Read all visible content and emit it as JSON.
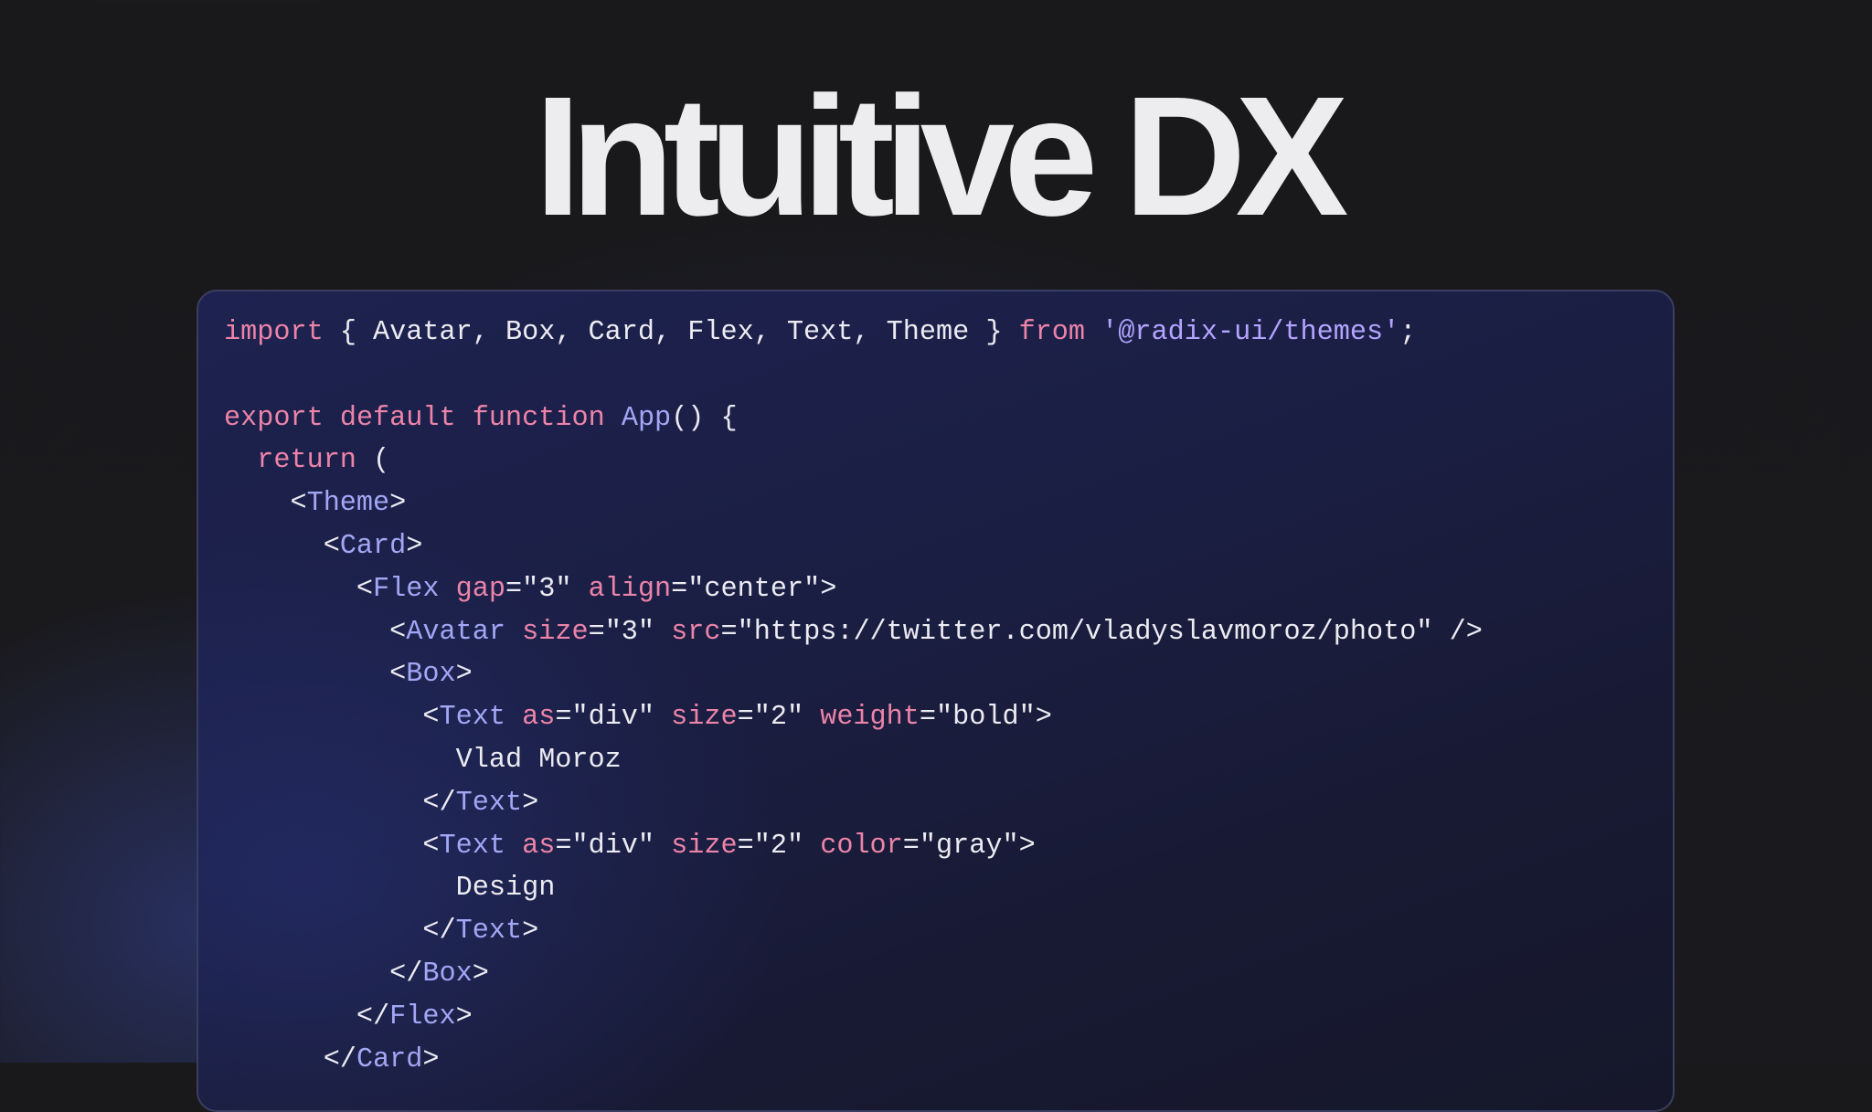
{
  "hero": {
    "title": "Intuitive DX"
  },
  "code": {
    "lines": [
      [
        {
          "t": "import",
          "k": "keyword"
        },
        {
          "t": " { Avatar, Box, Card, Flex, Text, Theme } ",
          "k": "plain"
        },
        {
          "t": "from",
          "k": "keyword"
        },
        {
          "t": " ",
          "k": "plain"
        },
        {
          "t": "'@radix-ui/themes'",
          "k": "string"
        },
        {
          "t": ";",
          "k": "plain"
        }
      ],
      [],
      [
        {
          "t": "export",
          "k": "keyword"
        },
        {
          "t": " ",
          "k": "plain"
        },
        {
          "t": "default",
          "k": "keyword"
        },
        {
          "t": " ",
          "k": "plain"
        },
        {
          "t": "function",
          "k": "keyword"
        },
        {
          "t": " ",
          "k": "plain"
        },
        {
          "t": "App",
          "k": "tag"
        },
        {
          "t": "() {",
          "k": "plain"
        }
      ],
      [
        {
          "t": "  ",
          "k": "plain"
        },
        {
          "t": "return",
          "k": "keyword"
        },
        {
          "t": " (",
          "k": "plain"
        }
      ],
      [
        {
          "t": "    <",
          "k": "plain"
        },
        {
          "t": "Theme",
          "k": "tag"
        },
        {
          "t": ">",
          "k": "plain"
        }
      ],
      [
        {
          "t": "      <",
          "k": "plain"
        },
        {
          "t": "Card",
          "k": "tag"
        },
        {
          "t": ">",
          "k": "plain"
        }
      ],
      [
        {
          "t": "        <",
          "k": "plain"
        },
        {
          "t": "Flex",
          "k": "tag"
        },
        {
          "t": " ",
          "k": "plain"
        },
        {
          "t": "gap",
          "k": "attr"
        },
        {
          "t": "=\"3\" ",
          "k": "plain"
        },
        {
          "t": "align",
          "k": "attr"
        },
        {
          "t": "=\"center\">",
          "k": "plain"
        }
      ],
      [
        {
          "t": "          <",
          "k": "plain"
        },
        {
          "t": "Avatar",
          "k": "tag"
        },
        {
          "t": " ",
          "k": "plain"
        },
        {
          "t": "size",
          "k": "attr"
        },
        {
          "t": "=\"3\" ",
          "k": "plain"
        },
        {
          "t": "src",
          "k": "attr"
        },
        {
          "t": "=\"https://twitter.com/vladyslavmoroz/photo\" />",
          "k": "plain"
        }
      ],
      [
        {
          "t": "          <",
          "k": "plain"
        },
        {
          "t": "Box",
          "k": "tag"
        },
        {
          "t": ">",
          "k": "plain"
        }
      ],
      [
        {
          "t": "            <",
          "k": "plain"
        },
        {
          "t": "Text",
          "k": "tag"
        },
        {
          "t": " ",
          "k": "plain"
        },
        {
          "t": "as",
          "k": "attr"
        },
        {
          "t": "=\"div\" ",
          "k": "plain"
        },
        {
          "t": "size",
          "k": "attr"
        },
        {
          "t": "=\"2\" ",
          "k": "plain"
        },
        {
          "t": "weight",
          "k": "attr"
        },
        {
          "t": "=\"bold\">",
          "k": "plain"
        }
      ],
      [
        {
          "t": "              Vlad Moroz",
          "k": "plain"
        }
      ],
      [
        {
          "t": "            </",
          "k": "plain"
        },
        {
          "t": "Text",
          "k": "tag"
        },
        {
          "t": ">",
          "k": "plain"
        }
      ],
      [
        {
          "t": "            <",
          "k": "plain"
        },
        {
          "t": "Text",
          "k": "tag"
        },
        {
          "t": " ",
          "k": "plain"
        },
        {
          "t": "as",
          "k": "attr"
        },
        {
          "t": "=\"div\" ",
          "k": "plain"
        },
        {
          "t": "size",
          "k": "attr"
        },
        {
          "t": "=\"2\" ",
          "k": "plain"
        },
        {
          "t": "color",
          "k": "attr"
        },
        {
          "t": "=\"gray\">",
          "k": "plain"
        }
      ],
      [
        {
          "t": "              Design",
          "k": "plain"
        }
      ],
      [
        {
          "t": "            </",
          "k": "plain"
        },
        {
          "t": "Text",
          "k": "tag"
        },
        {
          "t": ">",
          "k": "plain"
        }
      ],
      [
        {
          "t": "          </",
          "k": "plain"
        },
        {
          "t": "Box",
          "k": "tag"
        },
        {
          "t": ">",
          "k": "plain"
        }
      ],
      [
        {
          "t": "        </",
          "k": "plain"
        },
        {
          "t": "Flex",
          "k": "tag"
        },
        {
          "t": ">",
          "k": "plain"
        }
      ],
      [
        {
          "t": "      </",
          "k": "plain"
        },
        {
          "t": "Card",
          "k": "tag"
        },
        {
          "t": ">",
          "k": "plain"
        }
      ]
    ]
  },
  "colors": {
    "background": "#19191c",
    "title": "#ededef",
    "keyword": "#ec83a8",
    "string": "#b3a4ff",
    "component": "#a3a6f5",
    "plain": "#ecebf2",
    "card_border": "#3a3e60"
  }
}
